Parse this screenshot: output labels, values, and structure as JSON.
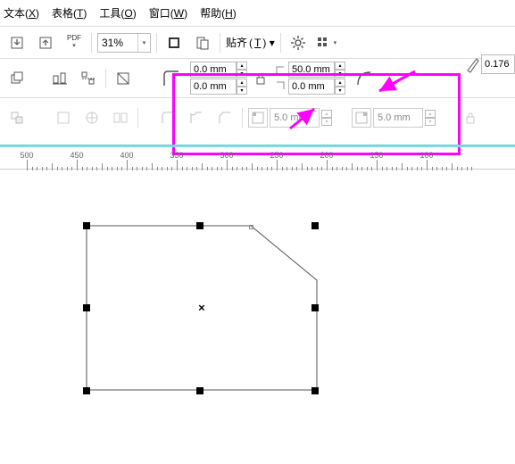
{
  "menu": {
    "text": {
      "label": "文本",
      "key": "X"
    },
    "table": {
      "label": "表格",
      "key": "T"
    },
    "tools": {
      "label": "工具",
      "key": "O"
    },
    "window": {
      "label": "窗口",
      "key": "W"
    },
    "help": {
      "label": "帮助",
      "key": "H"
    }
  },
  "toolbar1": {
    "zoom": "31%",
    "align": {
      "label": "贴齐",
      "key": "T"
    }
  },
  "corner_x": "0.0 mm",
  "corner_y": "0.0 mm",
  "arc_x": "50.0 mm",
  "arc_y": "0.0 mm",
  "tb3": {
    "rad1": "5.0 mm",
    "rad2": "5.0 mm"
  },
  "right_value": "0.176",
  "ruler": {
    "labels": [
      "500",
      "450",
      "400",
      "350",
      "300",
      "250",
      "200",
      "150",
      "100"
    ]
  },
  "chart_data": null
}
